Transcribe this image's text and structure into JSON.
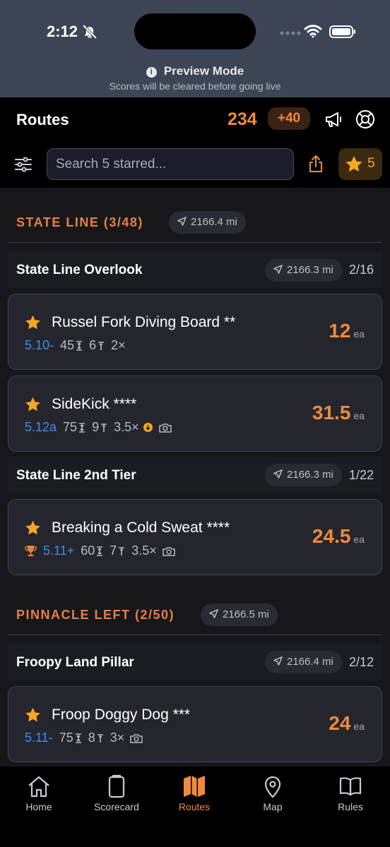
{
  "status_bar": {
    "time": "2:12"
  },
  "preview": {
    "title": "Preview Mode",
    "subtitle": "Scores will be cleared before going live"
  },
  "header": {
    "title": "Routes",
    "score": "234",
    "bonus": "+40"
  },
  "search": {
    "placeholder": "Search 5 starred...",
    "starred_count": "5"
  },
  "areas": [
    {
      "name": "STATE LINE (3/48)",
      "distance": "2166.4 mi",
      "walls": [
        {
          "name": "State Line Overlook",
          "distance": "2166.3 mi",
          "count": "2/16",
          "routes": [
            {
              "name": "Russel Fork Diving Board **",
              "grade": "5.10-",
              "height": "45",
              "bolts": "6",
              "multiplier": "2×",
              "points": "12",
              "unit": "ea"
            },
            {
              "name": "SideKick ****",
              "grade": "5.12a",
              "height": "75",
              "bolts": "9",
              "multiplier": "3.5×",
              "points": "31.5",
              "unit": "ea"
            }
          ]
        },
        {
          "name": "State Line 2nd Tier",
          "distance": "2166.3 mi",
          "count": "1/22",
          "routes": [
            {
              "name": "Breaking a Cold Sweat ****",
              "grade": "5.11+",
              "height": "60",
              "bolts": "7",
              "multiplier": "3.5×",
              "points": "24.5",
              "unit": "ea"
            }
          ]
        }
      ]
    },
    {
      "name": "PINNACLE LEFT (2/50)",
      "distance": "2166.5 mi",
      "walls": [
        {
          "name": "Froopy Land Pillar",
          "distance": "2166.4 mi",
          "count": "2/12",
          "routes": [
            {
              "name": "Froop Doggy Dog ***",
              "grade": "5.11-",
              "height": "75",
              "bolts": "8",
              "multiplier": "3×",
              "points": "24",
              "unit": "ea"
            }
          ]
        }
      ]
    }
  ],
  "tabs": [
    {
      "label": "Home",
      "icon": "home-icon"
    },
    {
      "label": "Scorecard",
      "icon": "scorecard-icon"
    },
    {
      "label": "Routes",
      "icon": "map-folded-icon",
      "active": true
    },
    {
      "label": "Map",
      "icon": "map-pin-icon"
    },
    {
      "label": "Rules",
      "icon": "book-icon"
    }
  ],
  "colors": {
    "accent": "#f08a3c",
    "star": "#f6a623",
    "grade": "#3f8cf2",
    "background": "#17171b"
  }
}
